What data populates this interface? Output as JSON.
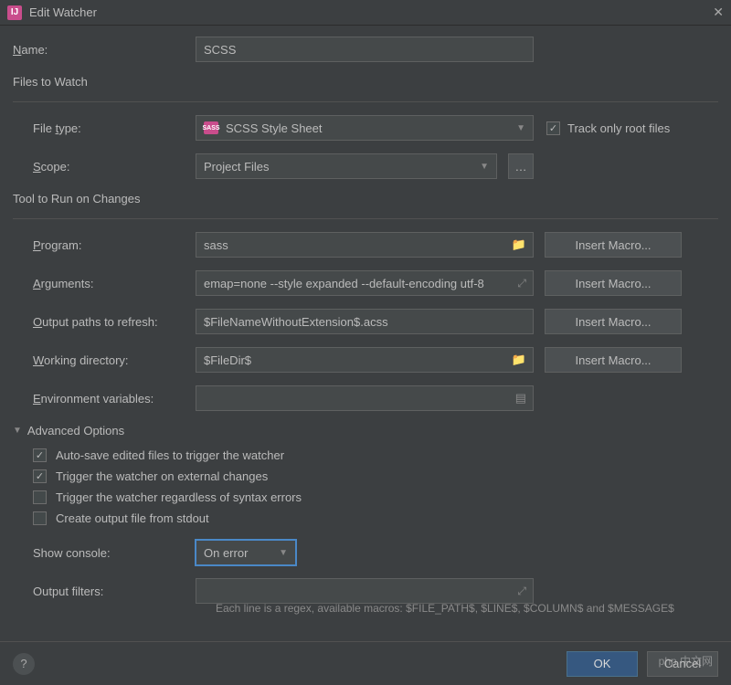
{
  "title": "Edit Watcher",
  "labels": {
    "name": "Name:",
    "files_to_watch": "Files to Watch",
    "file_type": "File type:",
    "scope": "Scope:",
    "track_root": "Track only root files",
    "tool_to_run": "Tool to Run on Changes",
    "program": "Program:",
    "arguments": "Arguments:",
    "output_paths": "Output paths to refresh:",
    "working_dir": "Working directory:",
    "env_vars": "Environment variables:",
    "advanced": "Advanced Options",
    "auto_save": "Auto-save edited files to trigger the watcher",
    "trigger_external": "Trigger the watcher on external changes",
    "trigger_syntax": "Trigger the watcher regardless of syntax errors",
    "create_stdout": "Create output file from stdout",
    "show_console": "Show console:",
    "output_filters": "Output filters:",
    "insert_macro": "Insert Macro...",
    "ok": "OK",
    "cancel": "Cancel"
  },
  "values": {
    "name": "SCSS",
    "file_type": "SCSS Style Sheet",
    "scope": "Project Files",
    "program": "sass",
    "arguments": "emap=none --style expanded --default-encoding utf-8",
    "output_paths": "$FileNameWithoutExtension$.acss",
    "working_dir": "$FileDir$",
    "env_vars": "",
    "show_console": "On error",
    "output_filters": ""
  },
  "checks": {
    "track_root": true,
    "auto_save": true,
    "trigger_external": true,
    "trigger_syntax": false,
    "create_stdout": false
  },
  "hint": "Each line is a regex, available macros: $FILE_PATH$, $LINE$, $COLUMN$ and $MESSAGE$",
  "icons": {
    "sass": "SASS"
  }
}
